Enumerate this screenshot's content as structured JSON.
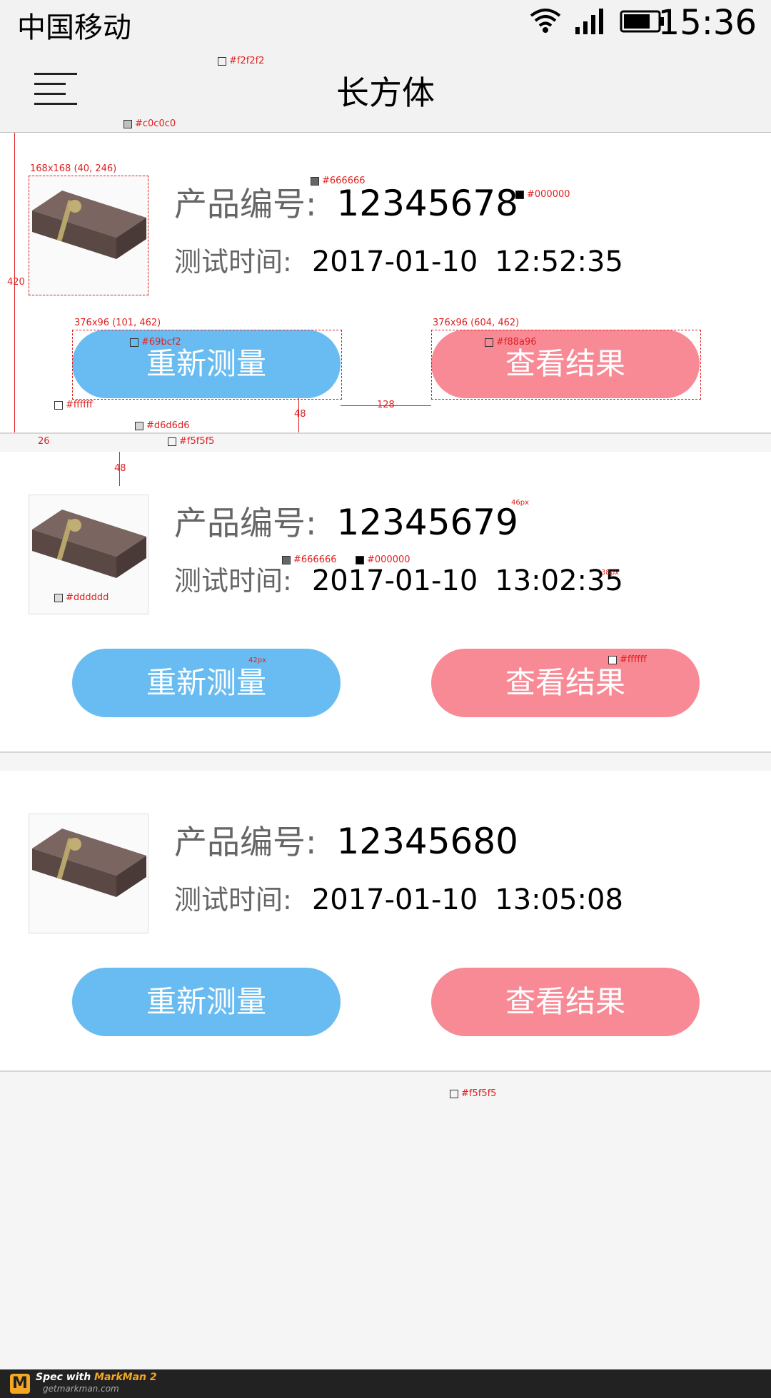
{
  "status_bar": {
    "carrier": "中国移动",
    "time": "15:36",
    "icons": [
      "wifi-icon",
      "signal-icon",
      "battery-icon"
    ]
  },
  "nav": {
    "title": "长方体",
    "menu_icon": "hamburger-menu-icon"
  },
  "labels": {
    "product_no": "产品编号:",
    "test_time": "测试时间:",
    "remeasure": "重新测量",
    "view_result": "查看结果"
  },
  "records": [
    {
      "product_no": "12345678",
      "date": "2017-01-10",
      "time": "12:52:35"
    },
    {
      "product_no": "12345679",
      "date": "2017-01-10",
      "time": "13:02:35"
    },
    {
      "product_no": "12345680",
      "date": "2017-01-10",
      "time": "13:05:08"
    }
  ],
  "colors": {
    "nav_bg": "#f2f2f2",
    "divider": "#c0c0c0",
    "label": "#666666",
    "value": "#000000",
    "remeasure_btn": "#69bcf2",
    "result_btn": "#f88a96",
    "card_bg": "#ffffff",
    "card_border": "#d6d6d6",
    "page_bg": "#f5f5f5",
    "thumb_border": "#dddddd"
  },
  "annotations": {
    "nav_bg": "#f2f2f2",
    "divider": "#c0c0c0",
    "thumb": "168x168 (40, 246)",
    "label_color": "#666666",
    "value_color": "#000000",
    "card_height": "420",
    "btn1": "376x96 (101, 462)",
    "btn1_color": "#69bcf2",
    "btn2": "376x96 (604, 462)",
    "btn2_color": "#f88a96",
    "card_bg": "#ffffff",
    "gap48": "48",
    "gap128": "128",
    "card_border": "#d6d6d6",
    "page_bg": "#f5f5f5",
    "gap26": "26",
    "gap48b": "48",
    "size46": "46px",
    "label_color2": "#666666",
    "value_color2": "#000000",
    "size38": "38px",
    "thumb_border": "#dddddd",
    "size42": "42px",
    "btn_text_color": "#ffffff",
    "page_bg2": "#f5f5f5"
  },
  "footer": {
    "brand_prefix": "Spec with ",
    "brand": "MarkMan 2",
    "site": "getmarkman.com",
    "logo": "M"
  }
}
